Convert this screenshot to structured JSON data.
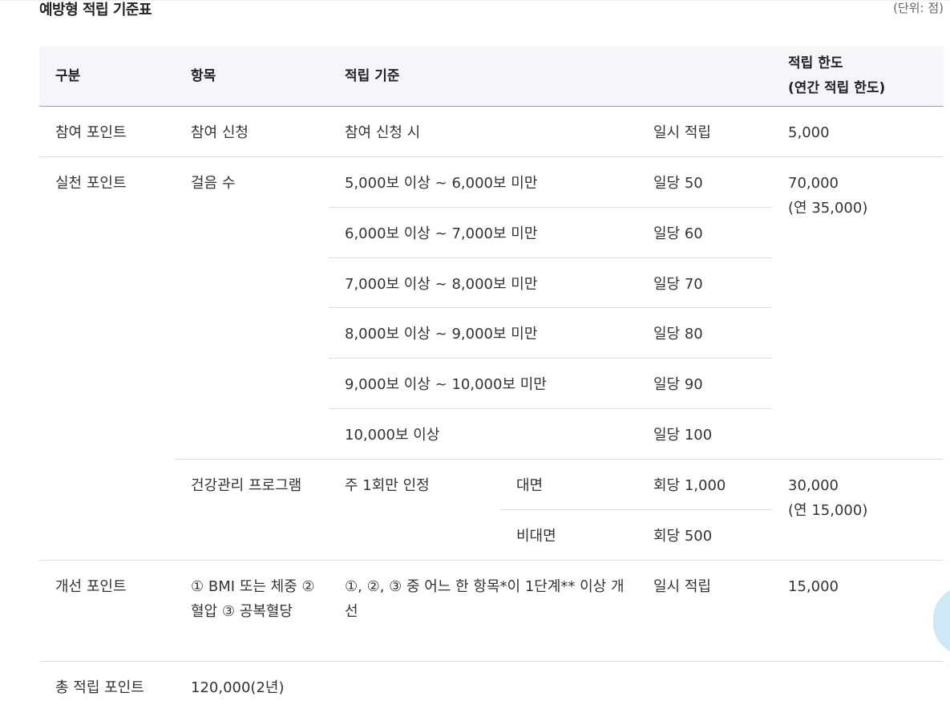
{
  "title": "예방형 적립 기준표",
  "unit": "(단위: 점)",
  "headers": {
    "category": "구분",
    "item": "항목",
    "criteria": "적립 기준",
    "limit_line1": "적립 한도",
    "limit_line2": "(연간 적립 한도)"
  },
  "participation": {
    "category": "참여 포인트",
    "item": "참여 신청",
    "criteria": "참여 신청 시",
    "points": "일시 적립",
    "limit": "5,000"
  },
  "practice": {
    "category": "실천 포인트",
    "walking": {
      "item": "걸음 수",
      "limit_line1": "70,000",
      "limit_line2": "(연 35,000)",
      "rows": [
        {
          "criteria": "5,000보 이상 ~ 6,000보 미만",
          "points": "일당 50"
        },
        {
          "criteria": "6,000보 이상 ~ 7,000보 미만",
          "points": "일당 60"
        },
        {
          "criteria": "7,000보 이상 ~ 8,000보 미만",
          "points": "일당 70"
        },
        {
          "criteria": "8,000보 이상 ~ 9,000보 미만",
          "points": "일당 80"
        },
        {
          "criteria": "9,000보 이상 ~ 10,000보 미만",
          "points": "일당 90"
        },
        {
          "criteria": "10,000보 이상",
          "points": "일당 100"
        }
      ]
    },
    "program": {
      "item": "건강관리 프로그램",
      "criteria": "주 1회만 인정",
      "limit_line1": "30,000",
      "limit_line2": "(연 15,000)",
      "rows": [
        {
          "type": "대면",
          "points": "회당 1,000"
        },
        {
          "type": "비대면",
          "points": "회당 500"
        }
      ]
    }
  },
  "improvement": {
    "category": "개선 포인트",
    "item": "① BMI 또는 체중 ② 혈압 ③ 공복혈당",
    "criteria": "①, ②, ③ 중 어느 한 항목*이 1단계** 이상 개선",
    "points": "일시 적립",
    "limit": "15,000"
  },
  "total": {
    "label": "총 적립 포인트",
    "value": "120,000(2년)"
  },
  "colors": {
    "header_bg": "#f5f6fa",
    "header_border": "#9aa3b8",
    "row_border": "#dddddd",
    "float_button": "#cfe8f8"
  }
}
